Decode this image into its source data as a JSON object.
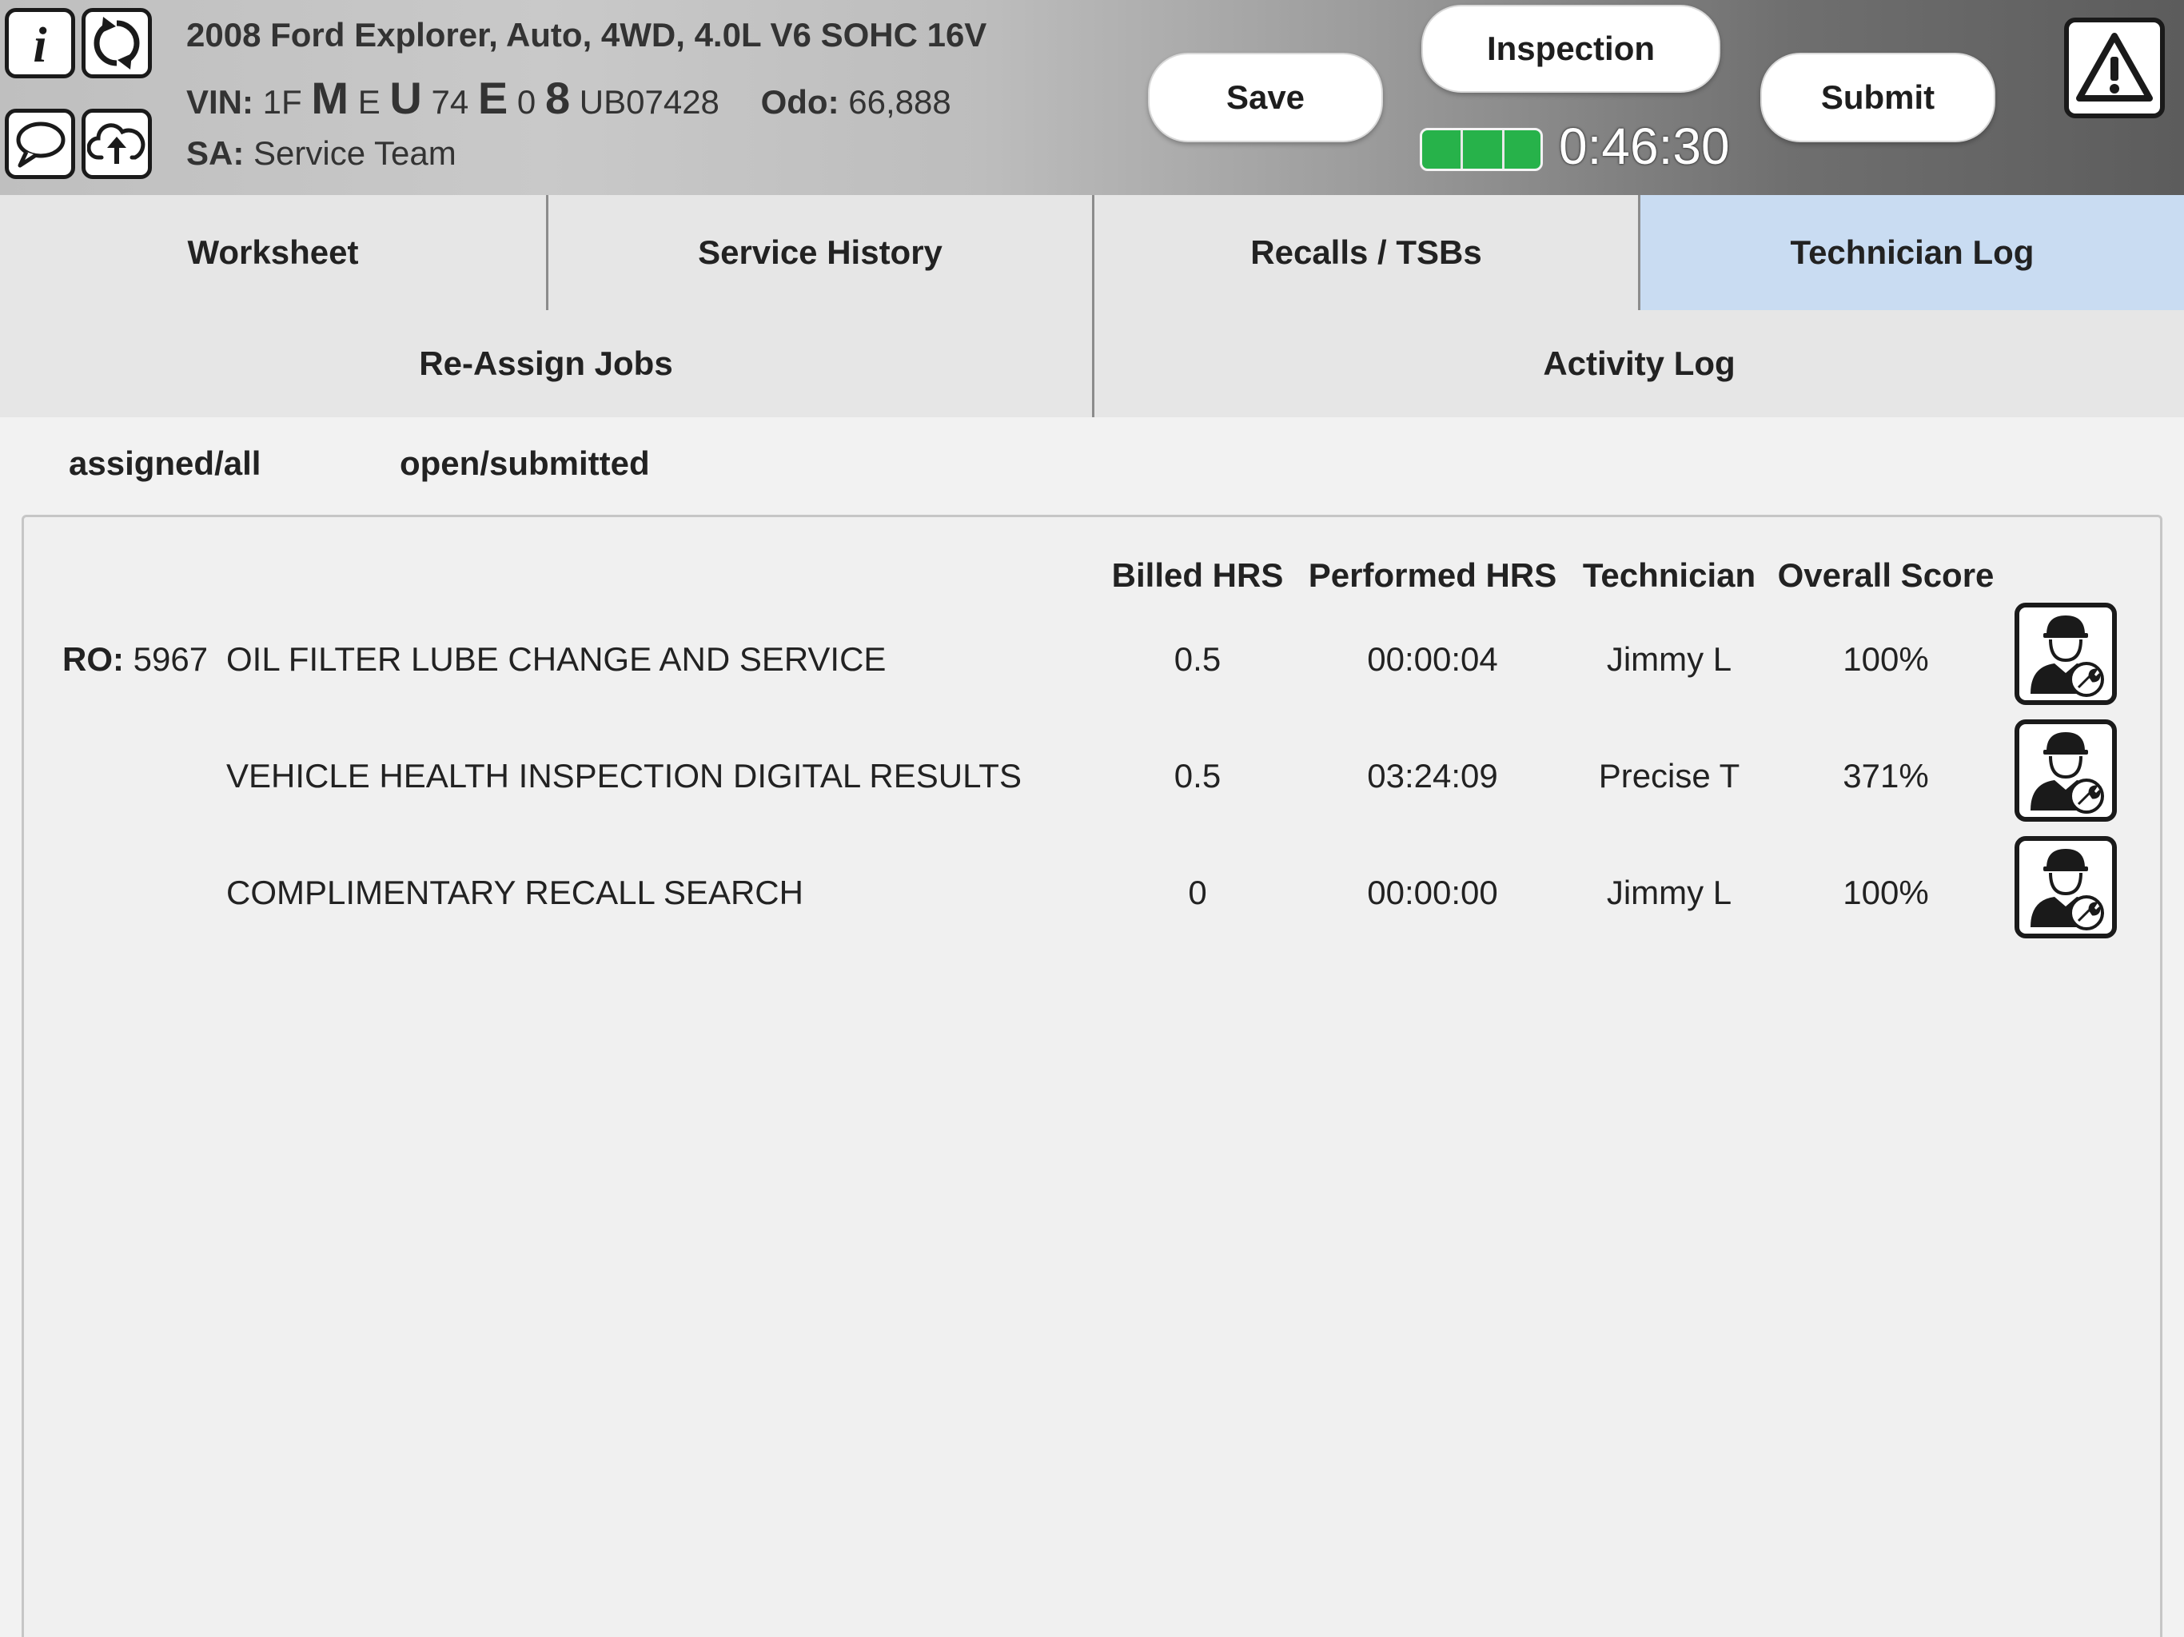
{
  "header": {
    "vehicle_title": "2008 Ford Explorer, Auto, 4WD, 4.0L V6 SOHC 16V",
    "vin_label": "VIN:",
    "vin_parts": [
      "1F",
      "M",
      "E",
      "U",
      "74",
      "E",
      "0",
      "8",
      "UB07428"
    ],
    "odo_label": "Odo:",
    "odo_value": "66,888",
    "sa_label": "SA:",
    "sa_value": "Service Team",
    "save_label": "Save",
    "inspection_label": "Inspection",
    "submit_label": "Submit",
    "timer": "0:46:30",
    "battery_color": "#27b24a"
  },
  "icons": {
    "info": "info-icon",
    "refresh": "refresh-icon",
    "chat": "chat-icon",
    "upload": "cloud-upload-icon",
    "warning": "warning-icon",
    "technician": "technician-icon"
  },
  "tabs": {
    "row1": [
      "Worksheet",
      "Service History",
      "Recalls / TSBs",
      "Technician Log"
    ],
    "row2": [
      "Re-Assign Jobs",
      "Activity Log"
    ],
    "active": "Technician Log",
    "active_color": "#c9dcf2"
  },
  "filters": {
    "assigned": "assigned/all",
    "open": "open/submitted"
  },
  "table": {
    "columns": [
      "Billed HRS",
      "Performed HRS",
      "Technician",
      "Overall Score"
    ],
    "ro_label": "RO:",
    "ro_number": "5967",
    "rows": [
      {
        "description": "OIL FILTER LUBE CHANGE AND SERVICE",
        "billed": "0.5",
        "performed": "00:00:04",
        "technician": "Jimmy L",
        "score": "100%"
      },
      {
        "description": "VEHICLE HEALTH INSPECTION DIGITAL RESULTS",
        "billed": "0.5",
        "performed": "03:24:09",
        "technician": "Precise T",
        "score": "371%"
      },
      {
        "description": "COMPLIMENTARY RECALL SEARCH",
        "billed": "0",
        "performed": "00:00:00",
        "technician": "Jimmy L",
        "score": "100%"
      }
    ]
  }
}
